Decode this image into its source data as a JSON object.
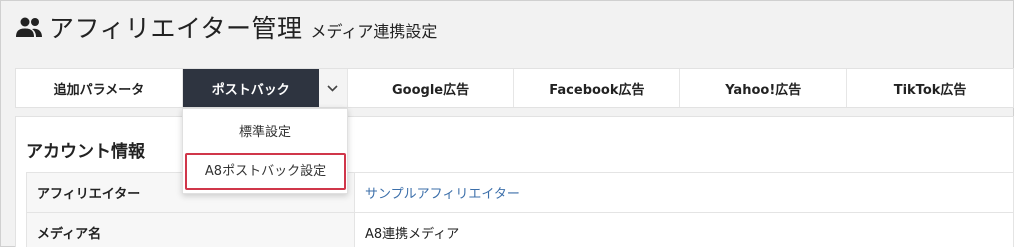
{
  "header": {
    "icon": "people-icon",
    "title": "アフィリエイター管理",
    "subtitle": "メディア連携設定"
  },
  "tabs": [
    {
      "label": "追加パラメータ",
      "active": false
    },
    {
      "label": "ポストバック",
      "active": true,
      "has_dropdown": true
    },
    {
      "label": "Google広告",
      "active": false
    },
    {
      "label": "Facebook広告",
      "active": false
    },
    {
      "label": "Yahoo!広告",
      "active": false
    },
    {
      "label": "TikTok広告",
      "active": false
    }
  ],
  "dropdown": {
    "items": [
      {
        "label": "標準設定",
        "highlighted": false
      },
      {
        "label": "A8ポストバック設定",
        "highlighted": true
      }
    ]
  },
  "account": {
    "title": "アカウント情報",
    "rows": [
      {
        "label": "アフィリエイター",
        "value": "サンプルアフィリエイター",
        "is_link": true
      },
      {
        "label": "メディア名",
        "value": "A8連携メディア",
        "is_link": false
      }
    ]
  },
  "colors": {
    "active_tab_bg": "#2e3440",
    "link": "#3c6faa",
    "highlight_border": "#d0364a"
  }
}
